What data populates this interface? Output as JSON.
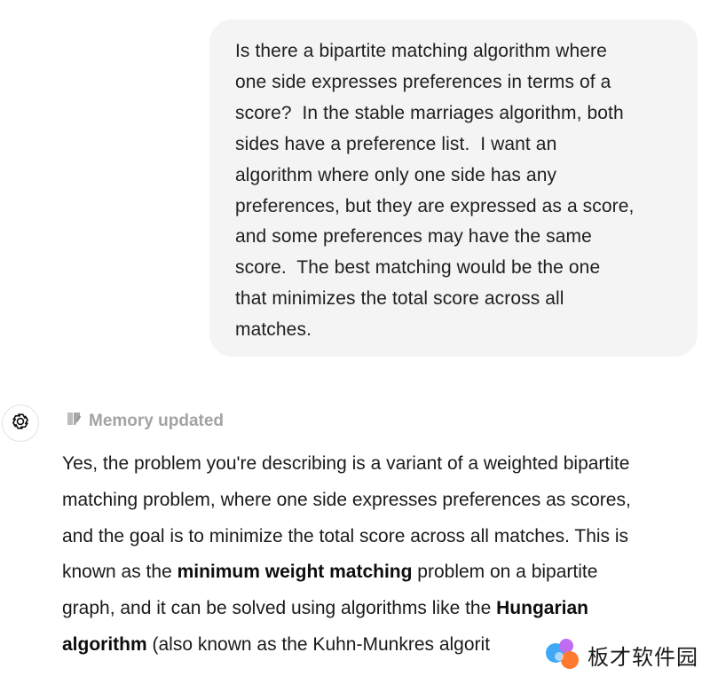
{
  "user_message": {
    "lines": [
      "Is there a bipartite matching algorithm where",
      "one side expresses preferences in terms of a",
      "score?  In the stable marriages algorithm, both",
      "sides have a preference list.  I want an",
      "algorithm where only one side has any",
      "preferences, but they are expressed as a score,",
      "and some preferences may have the same",
      "score.  The best matching would be the one",
      "that minimizes the total score across all",
      "matches."
    ]
  },
  "assistant": {
    "avatar_icon": "openai-logo-icon",
    "memory_icon": "memory-pencil-icon",
    "memory_label": "Memory updated",
    "response": {
      "l1": "Yes, the problem you're describing is a variant of a weighted bipartite",
      "l2": "matching problem, where one side expresses preferences as scores,",
      "l3": "and the goal is to minimize the total score across all matches. This is",
      "l4_pre": "known as the ",
      "l4_bold": "minimum weight matching",
      "l4_post": " problem on a bipartite",
      "l5_pre": "graph, and it can be solved using algorithms like the ",
      "l5_bold": "Hungarian",
      "l6_bold": "algorithm",
      "l6_post": " (also known as the Kuhn-Munkres algorit"
    }
  },
  "watermark": {
    "text": "板才软件园",
    "icon": "watermark-logo-icon"
  },
  "colors": {
    "bubble_bg": "#f4f4f4",
    "muted_text": "#a3a3a3",
    "text": "#1a1a1a"
  }
}
